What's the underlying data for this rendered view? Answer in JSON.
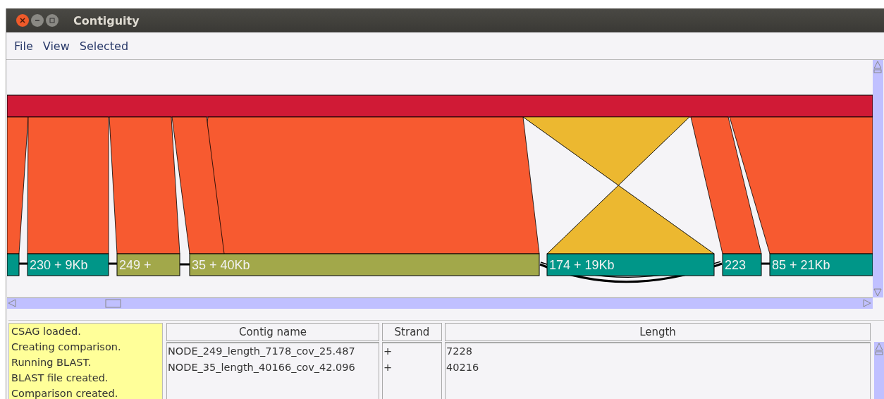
{
  "window": {
    "title": "Contiguity"
  },
  "menu": [
    "File",
    "View",
    "Selected"
  ],
  "diagram": {
    "contigs": [
      {
        "color": "#009688"
      },
      {
        "label": "230 + 9Kb",
        "color": "#009688"
      },
      {
        "label": "249 +",
        "color": "#a2a84a"
      },
      {
        "label": "35 + 40Kb",
        "color": "#a2a84a"
      },
      {
        "label": "174 + 19Kb",
        "color": "#009688"
      },
      {
        "label": "223",
        "color": "#009688"
      },
      {
        "label": "85 + 21Kb",
        "color": "#009688"
      }
    ]
  },
  "log": [
    "CSAG loaded.",
    "Creating comparison.",
    "Running BLAST.",
    "BLAST file created.",
    "Comparison created."
  ],
  "table": {
    "columns": [
      "Contig name",
      "Strand",
      "Length"
    ],
    "rows": [
      [
        "NODE_249_length_7178_cov_25.487",
        "+",
        "7228"
      ],
      [
        "NODE_35_length_40166_cov_42.096",
        "+",
        "40216"
      ]
    ]
  }
}
